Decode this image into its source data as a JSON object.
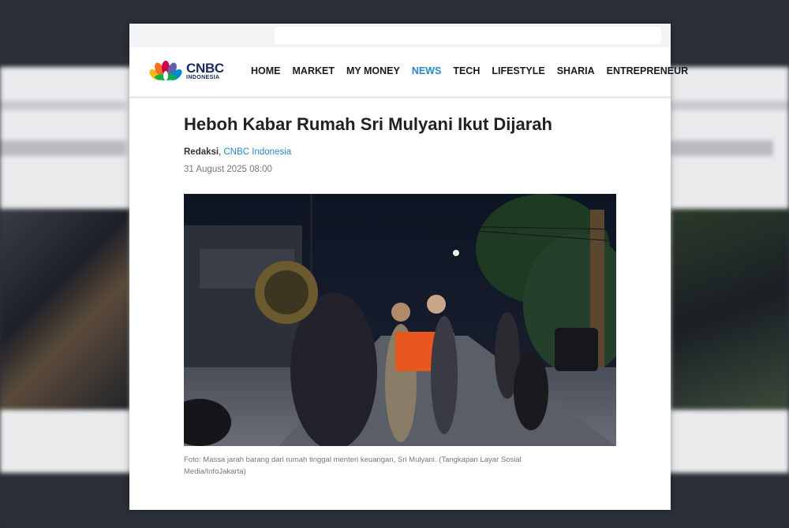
{
  "brand": {
    "name": "CNBC",
    "sub": "INDONESIA",
    "peacock_colors": [
      "#f37021",
      "#fcb711",
      "#cc004c",
      "#6460aa",
      "#0089d0",
      "#0db14b"
    ]
  },
  "nav": {
    "items": [
      "HOME",
      "MARKET",
      "MY MONEY",
      "NEWS",
      "TECH",
      "LIFESTYLE",
      "SHARIA",
      "ENTREPRENEUR"
    ],
    "active": "NEWS"
  },
  "article": {
    "title": "Heboh Kabar Rumah Sri Mulyani Ikut Dijarah",
    "author": "Redaksi",
    "outlet": "CNBC Indonesia",
    "date": "31 August 2025 08:00",
    "photo_icon": "street-night-crowd-photo",
    "caption": "Foto: Massa jarah barang dari rumah tinggal menteri keuangan, Sri Mulyani. (Tangkapan Layar Sosial Media/InfoJakarta)"
  },
  "colors": {
    "accent": "#2a87c7",
    "title": "#222222",
    "background": "#2b2f38"
  }
}
